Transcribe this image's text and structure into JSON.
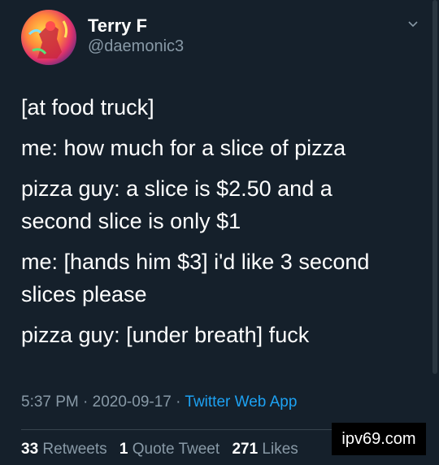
{
  "user": {
    "name": "Terry F",
    "handle": "@daemonic3"
  },
  "tweet": {
    "lines": [
      "[at food truck]",
      "me: how much for a slice of pizza",
      "pizza guy: a slice is $2.50 and a",
      "second slice is only $1",
      "me: [hands him $3] i'd like 3 second",
      "slices please",
      "pizza guy: [under breath] fuck"
    ],
    "time": "5:37 PM",
    "date": "2020-09-17",
    "separator": "·",
    "source": "Twitter Web App"
  },
  "stats": {
    "retweets_count": "33",
    "retweets_label": "Retweets",
    "quotes_count": "1",
    "quotes_label": "Quote Tweet",
    "likes_count": "271",
    "likes_label": "Likes"
  },
  "watermark": "ipv69.com",
  "colors": {
    "background": "#15202b",
    "text": "#ffffff",
    "secondary": "#8899a6",
    "link": "#1da1f2",
    "divider": "#38444d"
  },
  "icons": {
    "avatar": "avatar-illustration",
    "caret": "chevron-down-icon"
  }
}
